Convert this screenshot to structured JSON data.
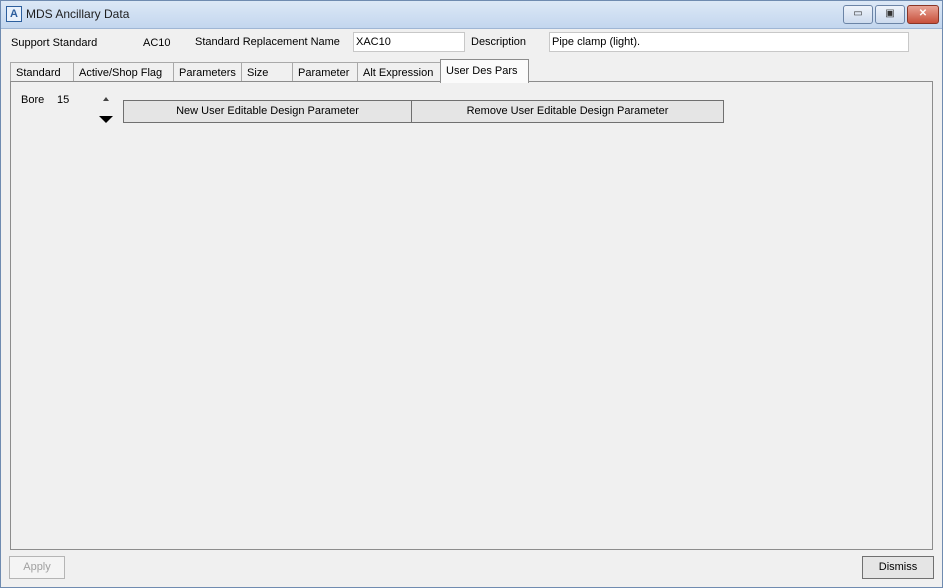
{
  "window": {
    "title": "MDS Ancillary Data",
    "controls": {
      "minimize": "▭",
      "maximize": "▣",
      "close": "✕"
    }
  },
  "header": {
    "support_standard_label": "Support Standard",
    "support_standard_value": "AC10",
    "replacement_name_label": "Standard Replacement Name",
    "replacement_name_value": "XAC10",
    "description_label": "Description",
    "description_value": "Pipe clamp (light)."
  },
  "tabs": [
    {
      "label": "Standard"
    },
    {
      "label": "Active/Shop Flag"
    },
    {
      "label": "Parameters"
    },
    {
      "label": "Size"
    },
    {
      "label": "Parameter"
    },
    {
      "label": "Alt Expression"
    },
    {
      "label": "User Des Pars"
    }
  ],
  "active_tab": "User Des Pars",
  "panel": {
    "bore_label": "Bore",
    "bore_value": "15",
    "new_param_button": "New User Editable Design Parameter",
    "remove_param_button": "Remove User Editable Design Parameter"
  },
  "footer": {
    "apply_label": "Apply",
    "dismiss_label": "Dismiss"
  },
  "icons": {
    "app": "app-logo-icon",
    "bore_up": "up-arrow-icon",
    "bore_down": "down-arrow-icon"
  }
}
